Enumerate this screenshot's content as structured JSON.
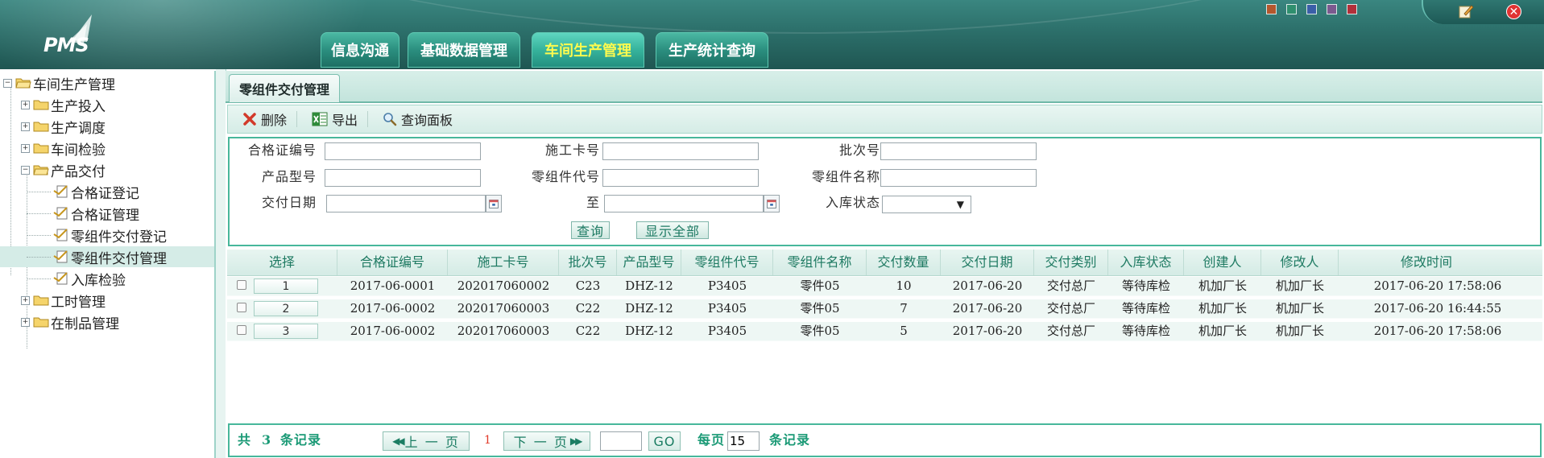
{
  "app": {
    "logo_text": "PMS"
  },
  "top_nav": [
    {
      "label": "信息沟通"
    },
    {
      "label": "基础数据管理"
    },
    {
      "label": "车间生产管理",
      "active": true
    },
    {
      "label": "生产统计查询"
    }
  ],
  "theme_swatches": [
    "#b4572d",
    "#2f8f6e",
    "#3a5fa8",
    "#7c5a8f",
    "#b2303a"
  ],
  "tree": {
    "root": "车间生产管理",
    "items": [
      {
        "label": "生产投入"
      },
      {
        "label": "生产调度"
      },
      {
        "label": "车间检验"
      },
      {
        "label": "产品交付"
      },
      {
        "label": "合格证登记"
      },
      {
        "label": "合格证管理"
      },
      {
        "label": "零组件交付登记"
      },
      {
        "label": "零组件交付管理"
      },
      {
        "label": "入库检验"
      },
      {
        "label": "工时管理"
      },
      {
        "label": "在制品管理"
      }
    ]
  },
  "content_tab": "零组件交付管理",
  "toolbar": {
    "delete": "删除",
    "export": "导出",
    "query_panel": "查询面板"
  },
  "query": {
    "cert_no_label": "合格证编号",
    "work_card_label": "施工卡号",
    "batch_no_label": "批次号",
    "product_model_label": "产品型号",
    "part_code_label": "零组件代号",
    "part_name_label": "零组件名称",
    "delivery_date_label": "交付日期",
    "to_label": "至",
    "storage_status_label": "入库状态",
    "cert_no": "",
    "work_card": "",
    "batch_no": "",
    "product_model": "",
    "part_code": "",
    "part_name": "",
    "date_from": "",
    "date_to": "",
    "storage_status": "",
    "search_btn": "查询",
    "show_all_btn": "显示全部"
  },
  "grid": {
    "headers": [
      "选择",
      "合格证编号",
      "施工卡号",
      "批次号",
      "产品型号",
      "零组件代号",
      "零组件名称",
      "交付数量",
      "交付日期",
      "交付类别",
      "入库状态",
      "创建人",
      "修改人",
      "修改时间"
    ],
    "rows": [
      {
        "num": "1",
        "cert": "2017-06-0001",
        "card": "202017060002",
        "batch": "C23",
        "model": "DHZ-12",
        "code": "P3405",
        "name": "零件05",
        "qty": "10",
        "date": "2017-06-20",
        "type": "交付总厂",
        "status": "等待库检",
        "creator": "机加厂长",
        "modifier": "机加厂长",
        "mtime": "2017-06-20 17:58:06"
      },
      {
        "num": "2",
        "cert": "2017-06-0002",
        "card": "202017060003",
        "batch": "C22",
        "model": "DHZ-12",
        "code": "P3405",
        "name": "零件05",
        "qty": "7",
        "date": "2017-06-20",
        "type": "交付总厂",
        "status": "等待库检",
        "creator": "机加厂长",
        "modifier": "机加厂长",
        "mtime": "2017-06-20 16:44:55"
      },
      {
        "num": "3",
        "cert": "2017-06-0002",
        "card": "202017060003",
        "batch": "C22",
        "model": "DHZ-12",
        "code": "P3405",
        "name": "零件05",
        "qty": "5",
        "date": "2017-06-20",
        "type": "交付总厂",
        "status": "等待库检",
        "creator": "机加厂长",
        "modifier": "机加厂长",
        "mtime": "2017-06-20 17:58:06"
      }
    ]
  },
  "pager": {
    "total_prefix": "共",
    "total_count": "3",
    "total_suffix": "条记录",
    "prev": "上 一 页",
    "current_page": "1",
    "next": "下 一 页",
    "goto_value": "",
    "go": "GO",
    "per_page_label": "每页",
    "per_page_value": "15",
    "per_page_suffix": "条记录"
  }
}
